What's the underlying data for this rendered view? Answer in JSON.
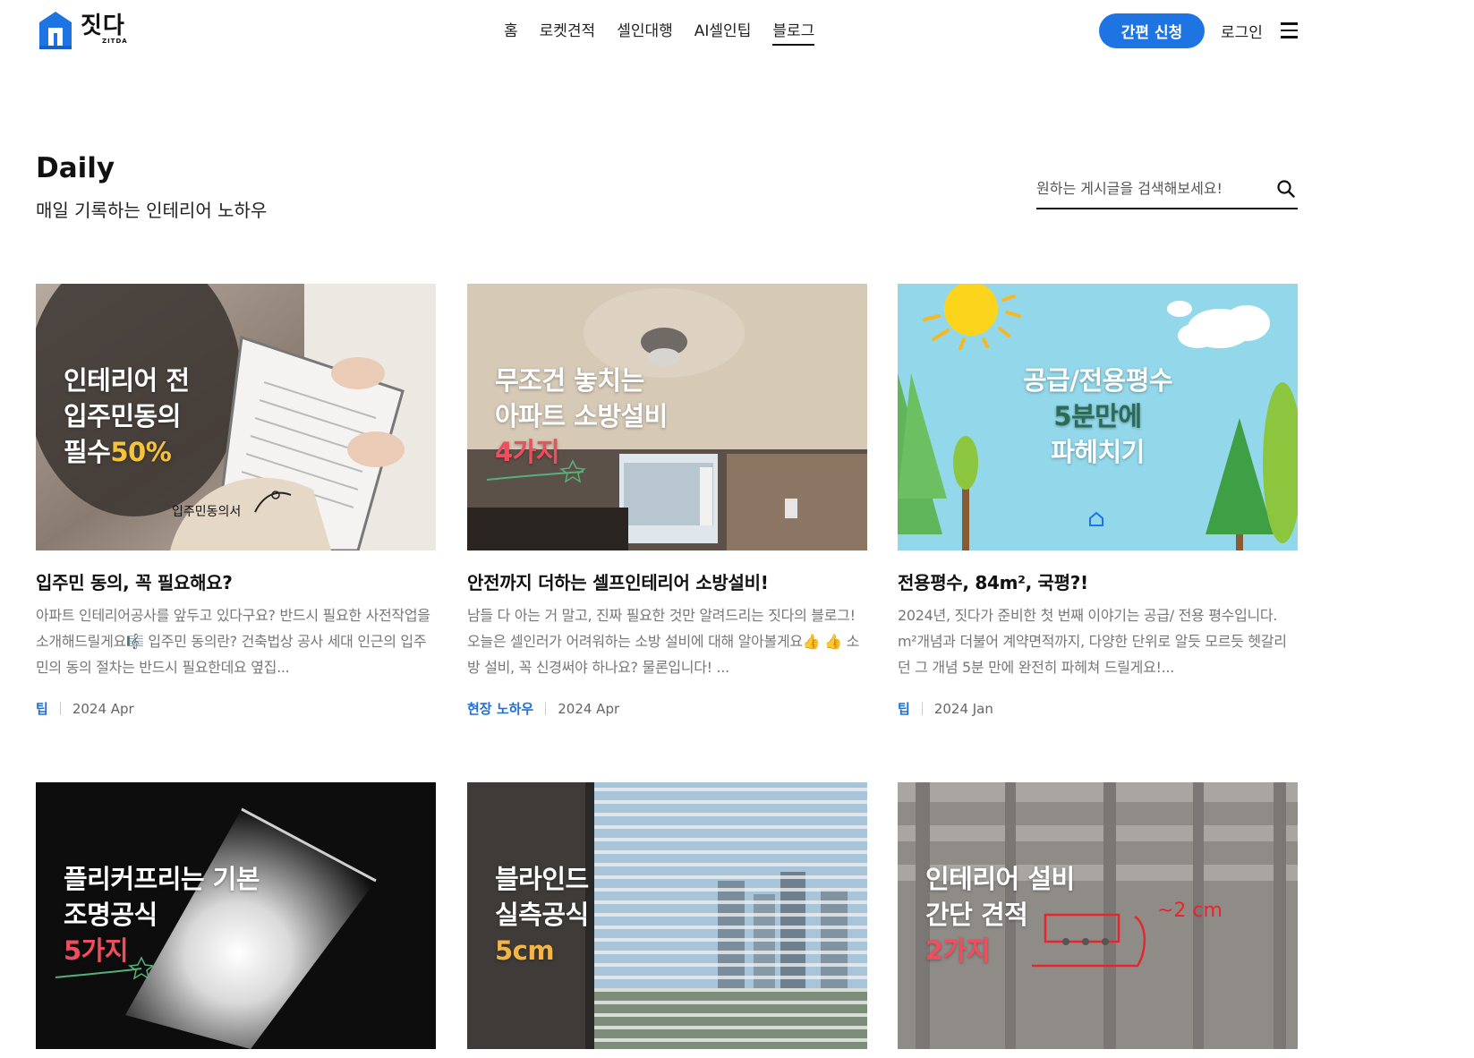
{
  "header": {
    "logo_text": "짓다",
    "logo_sub": "ZITDA",
    "nav": [
      {
        "label": "홈",
        "active": false
      },
      {
        "label": "로켓견적",
        "active": false
      },
      {
        "label": "셀인대행",
        "active": false
      },
      {
        "label": "AI셀인팁",
        "active": false
      },
      {
        "label": "블로그",
        "active": true
      }
    ],
    "cta_label": "간편 신청",
    "login_label": "로그인"
  },
  "page": {
    "title": "Daily",
    "subtitle": "매일 기록하는 인테리어 노하우"
  },
  "search": {
    "placeholder": "원하는 게시글을 검색해보세요!"
  },
  "posts": [
    {
      "thumb_lines": [
        "인테리어 전",
        "입주민동의",
        "필수"
      ],
      "thumb_highlight": "50%",
      "thumb_caption": "입주민동의서",
      "title": "입주민 동의, 꼭 필요해요?",
      "desc": " 아파트 인테리어공사를 앞두고 있다구요? 반드시 필요한 사전작업을 소개해드릴게요🎼 입주민 동의란? 건축법상 공사 세대 인근의 입주민의 동의 절차는 반드시 필요한데요 옆집...",
      "tag": "팁",
      "date": "2024 Apr"
    },
    {
      "thumb_lines": [
        "무조건 놓치는",
        "아파트 소방설비"
      ],
      "thumb_highlight": "4가지",
      "title": "안전까지 더하는 셀프인테리어 소방설비!",
      "desc": "남들 다 아는 거 말고, 진짜 필요한 것만 알려드리는 짓다의 블로그! 오늘은 셀인러가 어려워하는 소방 설비에 대해 알아볼게요👍 👍 소방 설비, 꼭 신경써야 하나요? 물론입니다! ...",
      "tag": "현장 노하우",
      "date": "2024 Apr"
    },
    {
      "thumb_lines": [
        "공급/전용평수",
        "5분만에",
        "파헤치기"
      ],
      "title": "전용평수, 84m², 국평?!",
      "desc": "2024년, 짓다가 준비한 첫 번째 이야기는 공급/ 전용 평수입니다. m²개념과 더불어 계약면적까지, 다양한 단위로 알듯 모르듯 헷갈리던 그 개념 5분 만에 완전히 파헤쳐 드릴게요!...",
      "tag": "팁",
      "date": "2024 Jan"
    },
    {
      "thumb_lines": [
        "플리커프리는 기본",
        "조명공식"
      ],
      "thumb_highlight": "5가지"
    },
    {
      "thumb_lines": [
        "블라인드",
        "실측공식"
      ],
      "thumb_highlight": "5cm"
    },
    {
      "thumb_lines": [
        "인테리어 설비",
        "간단 견적"
      ],
      "thumb_highlight": "2가지"
    }
  ],
  "colors": {
    "brand_blue": "#1f74e4",
    "tag_blue": "#1f6fd8",
    "highlight_yellow": "#f5c33b",
    "highlight_red": "#ee4e5e",
    "highlight_orange": "#f3b548"
  }
}
